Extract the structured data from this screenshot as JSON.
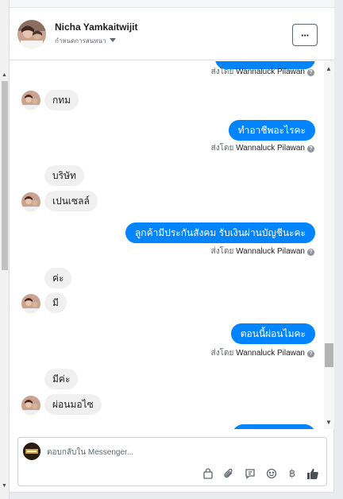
{
  "header": {
    "name": "Nicha Yamkaitwijit",
    "subtitle": "กำหนดการสนทนา",
    "more_label": "···"
  },
  "sent_by": {
    "prefix": "ส่งโดย",
    "agent": "Wannaluck Pilawan",
    "help": "?"
  },
  "messages": {
    "in_1": "กทม",
    "out_1": "ทำอาชีพอะไรคะ",
    "in_2": "บริษัท",
    "in_3": "เปนเซลล์",
    "out_2": "ลูกค้ามีประกันสังคม รับเงินผ่านบัญชีนะคะ",
    "in_4": "ค่ะ",
    "in_5": "มี",
    "out_3": "ตอนนี้ผ่อนไมคะ",
    "in_6": "มีค่ะ",
    "in_7": "ผ่อนมอไซ"
  },
  "composer": {
    "placeholder": "ตอบกลับใน Messenger...",
    "baht_symbol": "฿"
  },
  "colors": {
    "outgoing_bubble": "#0084ff",
    "incoming_bubble": "#f1f0f0",
    "icon": "#606770"
  }
}
